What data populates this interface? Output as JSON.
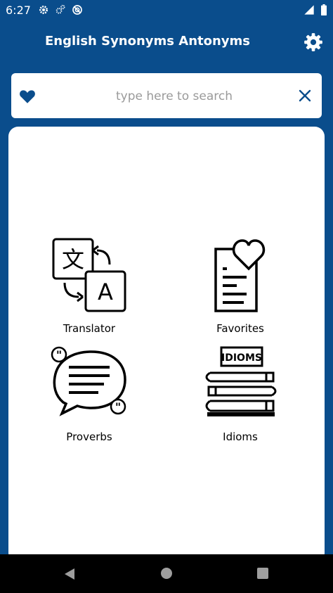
{
  "status_bar": {
    "time": "6:27"
  },
  "app_bar": {
    "title": "English Synonyms Antonyms"
  },
  "search": {
    "placeholder": "type here to search",
    "value": ""
  },
  "tiles": [
    {
      "label": "Translator"
    },
    {
      "label": "Favorites"
    },
    {
      "label": "Proverbs"
    },
    {
      "label": "Idioms",
      "book_label": "IDIOMS"
    }
  ],
  "translator_icon": {
    "glyph_left": "文",
    "glyph_right": "A"
  },
  "colors": {
    "primary": "#0a4d8c",
    "surface": "#ffffff",
    "nav_bar": "#000000"
  }
}
